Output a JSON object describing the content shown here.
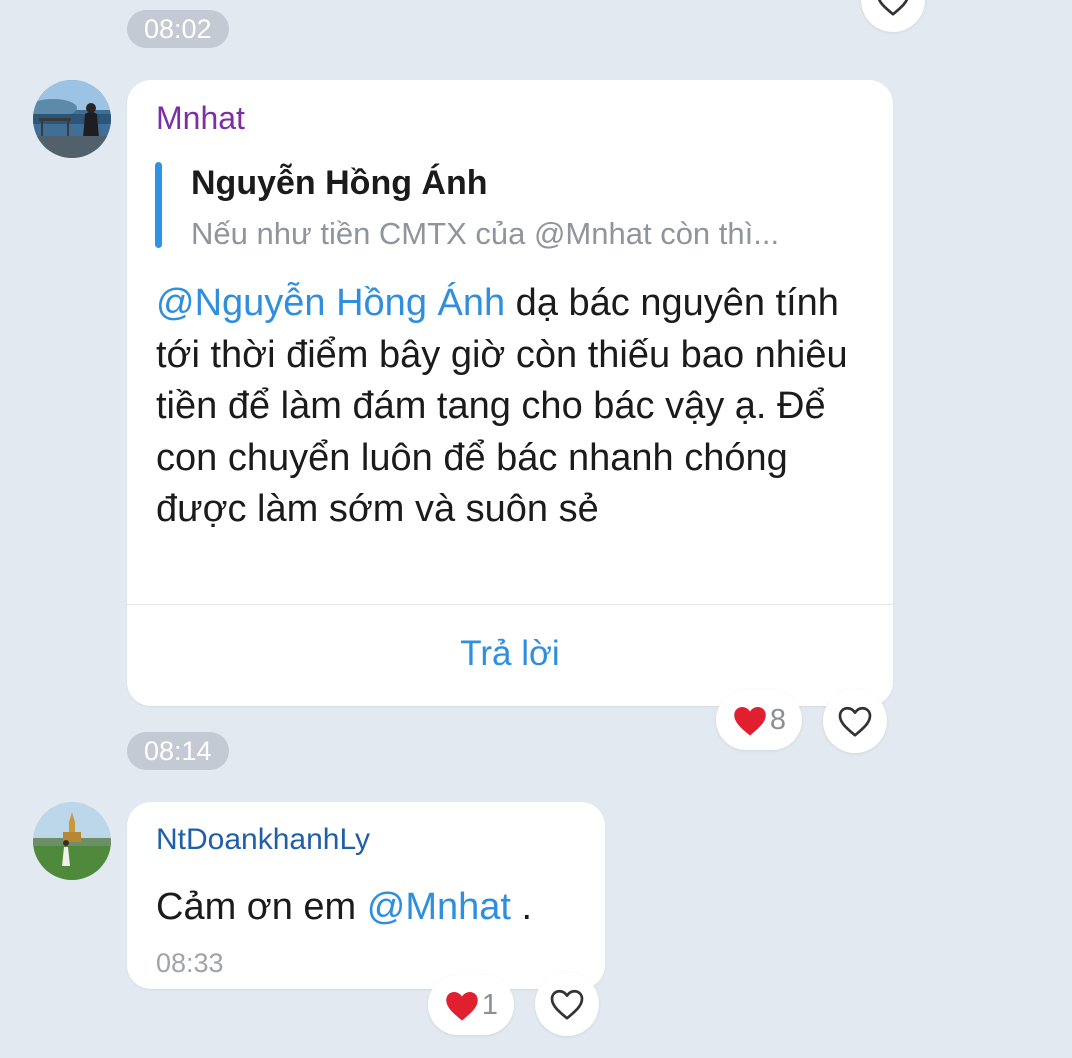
{
  "colors": {
    "background": "#e2e9f1",
    "accent": "#2f8fdc",
    "sender_purple": "#7b2fa6",
    "sender_blue": "#1f5fa8",
    "heart_red": "#e0202f"
  },
  "timestamps": {
    "divider_1": "08:02",
    "divider_2": "08:14"
  },
  "messages": [
    {
      "sender": "Mnhat",
      "avatar_icon": "user-avatar-photo",
      "quote": {
        "name": "Nguyễn Hồng Ánh",
        "text": "Nếu như tiền CMTX của @Mnhat còn thì..."
      },
      "mention": "@Nguyễn Hồng Ánh",
      "text": " dạ bác nguyên tính tới thời điểm bây giờ còn thiếu bao nhiêu tiền để làm đám tang cho bác vậy ạ. Để con chuyển luôn để bác nhanh chóng được làm sớm và suôn sẻ",
      "reply_label": "Trả lời",
      "reaction_icon": "red-heart-icon",
      "reaction_count": "8",
      "like_icon": "heart-outline-icon"
    },
    {
      "sender": "NtDoankhanhLy",
      "avatar_icon": "user-avatar-photo",
      "text_before": "Cảm ơn em ",
      "mention": "@Mnhat",
      "text_after": " .",
      "time": "08:33",
      "reaction_icon": "red-heart-icon",
      "reaction_count": "1",
      "like_icon": "heart-outline-icon"
    }
  ]
}
